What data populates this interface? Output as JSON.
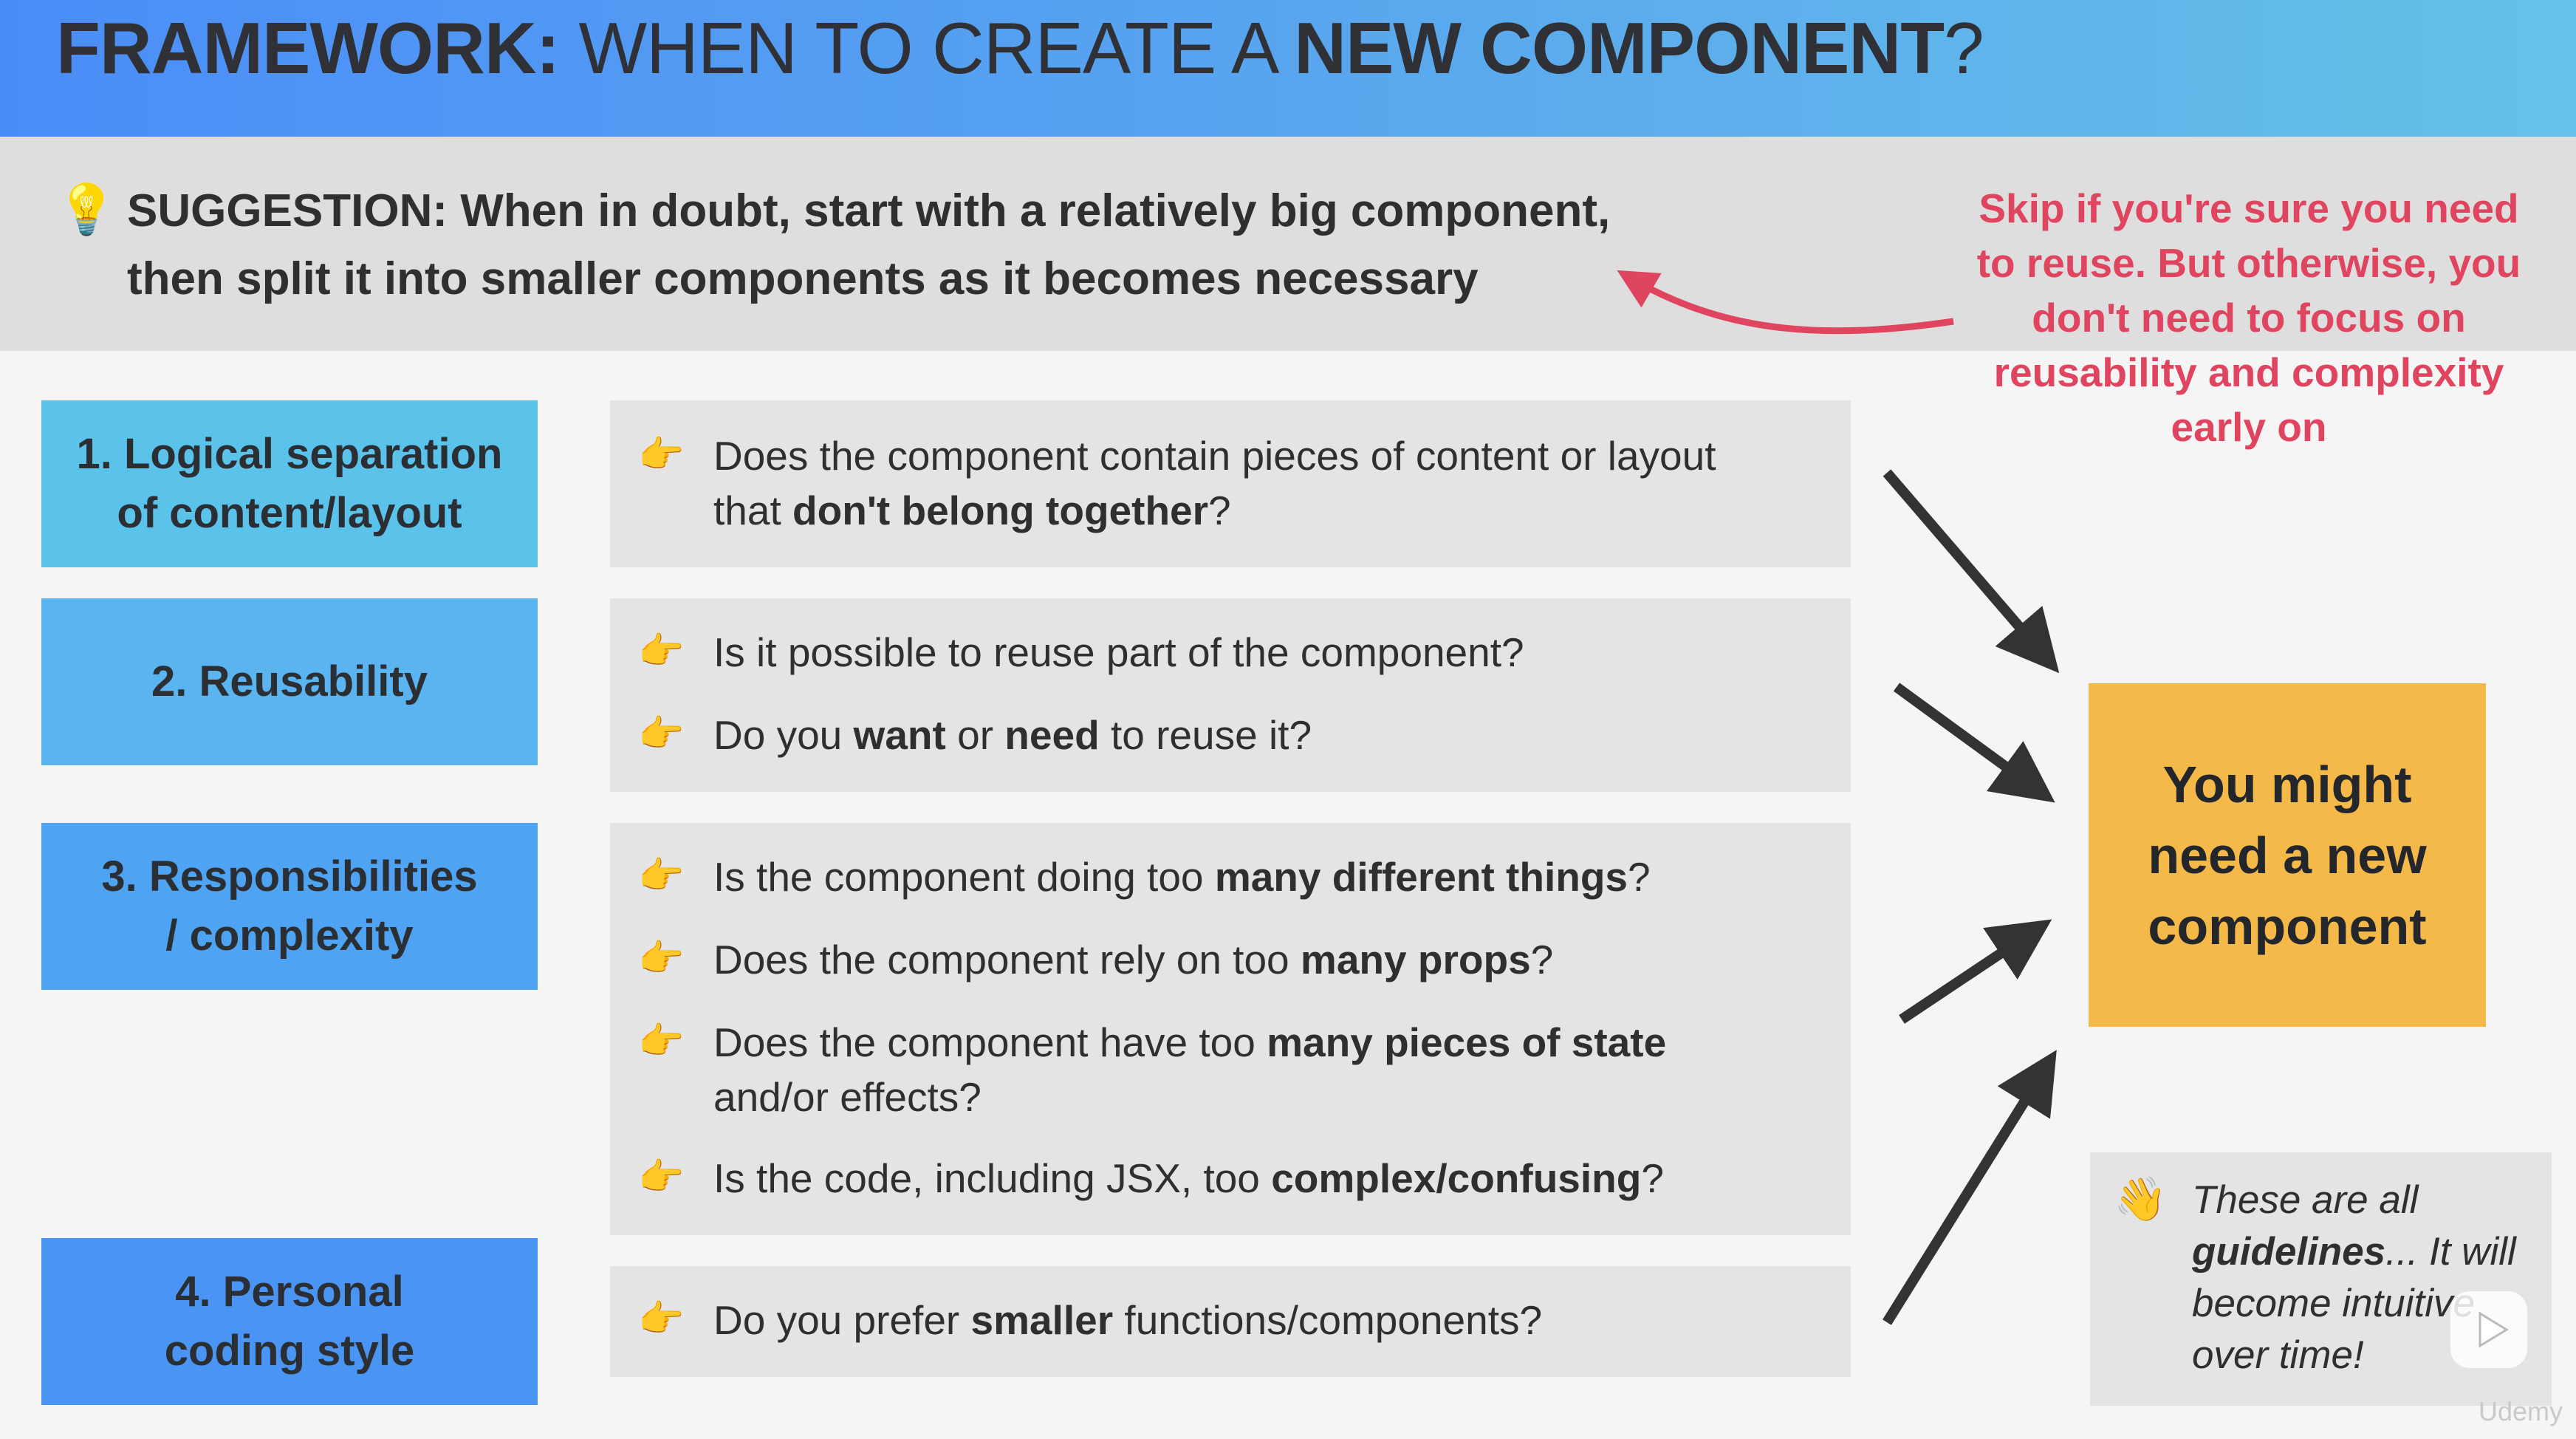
{
  "header": {
    "title_bold": "FRAMEWORK:",
    "title_mid": " WHEN TO CREATE A ",
    "title_bold2": "NEW COMPONENT",
    "title_end": "?"
  },
  "suggestion": {
    "label": "SUGGESTION:",
    "line1": " When in doubt, start with a relatively big component,",
    "line2": "then split it into smaller components as it becomes necessary",
    "icon": "lightbulb-icon"
  },
  "side_note": {
    "text": "Skip if you're sure you need to reuse. But otherwise, you don't need to focus on reusability and complexity early on",
    "color": "#e0455f"
  },
  "criteria": [
    {
      "label_line1": "1. Logical separation",
      "label_line2": "of content/layout",
      "color": "#5bc2ea"
    },
    {
      "label_line1": "2. Reusability",
      "label_line2": "",
      "color": "#5ab4ef"
    },
    {
      "label_line1": "3. Responsibilities",
      "label_line2": "/ complexity",
      "color": "#4ea3f2"
    },
    {
      "label_line1": "4. Personal",
      "label_line2": "coding style",
      "color": "#4a94f4"
    }
  ],
  "questions": {
    "q1a_pre": "Does the component contain pieces of content or layout",
    "q1a_pre2": "that ",
    "q1a_bold": "don't belong together",
    "q1a_post": "?",
    "q2a": "Is it possible to reuse part of the component?",
    "q2b_pre": "Do you ",
    "q2b_bold1": "want",
    "q2b_mid": " or ",
    "q2b_bold2": "need",
    "q2b_post": " to reuse it?",
    "q3a_pre": "Is the component doing too ",
    "q3a_bold": "many different things",
    "q3a_post": "?",
    "q3b_pre": "Does the component rely on too ",
    "q3b_bold": "many props",
    "q3b_post": "?",
    "q3c_pre": "Does the component have too ",
    "q3c_bold": "many pieces of state",
    "q3c_line2": "and/or effects?",
    "q3d_pre": "Is the code, including JSX, too ",
    "q3d_bold": "complex/confusing",
    "q3d_post": "?",
    "q4a_pre": "Do you prefer ",
    "q4a_bold": "smaller",
    "q4a_post": " functions/components?",
    "bullet_icon": "pointing-hand-icon"
  },
  "result": {
    "line1": "You might",
    "line2": "need a new",
    "line3": "component",
    "color": "#f5b94a"
  },
  "guidelines": {
    "pre": "These are all ",
    "bold": "guidelines",
    "post": "... It will become intuitive over time!",
    "icon": "waving-hand-icon"
  },
  "watermark": {
    "brand": "Udemy",
    "play_icon": "play-icon"
  }
}
